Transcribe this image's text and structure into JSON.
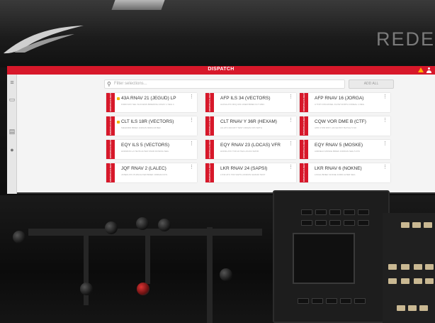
{
  "background": {
    "brand_text": "REDE"
  },
  "app": {
    "title": "DISPATCH",
    "accent_color": "#d7182a",
    "warning_color": "#ffb300",
    "icons": {
      "warning": "warning-icon",
      "user": "user-icon",
      "search": "search-icon"
    }
  },
  "toolbar": {
    "search_placeholder": "Filter selections...",
    "add_label": "ADD ALL"
  },
  "sidebar": {
    "icons": [
      "menu-icon",
      "monitor-icon",
      "chart-icon",
      "location-icon"
    ]
  },
  "cards": [
    {
      "name": "43A RNAV 21 (JEGUD) LP",
      "sub": "FORD RAY SEL SUCCESS BRIEFING ASSAY 1 SEG 4",
      "tab": "DISPATCH FLIGHT",
      "flag": true
    },
    {
      "name": "AFP ILS 34 (VECTORS)",
      "sub": "ALPHA ATC RFQ 003 LINER BRIEF FLT 3093",
      "tab": "DISPATCH FLIGHT",
      "flag": false
    },
    {
      "name": "AFP RNAV 16 (JORGA)",
      "sub": "A TOP COM ANSEL FLOW NORTH JOREAL 1 REG",
      "tab": "DISPATCH FLIGHT",
      "flag": false
    },
    {
      "name": "CLT ILS 18R (VECTORS)",
      "sub": "SIEGFRID BRIEF JORGIN MDRLNZ BEF",
      "tab": "DISPATCH FLIGHT",
      "flag": true
    },
    {
      "name": "CLT RNAV Y 36R (HEXAM)",
      "sub": "AIL ATC 003 RFT TEST ORIGIN FFS SMTH",
      "tab": "DISPATCH FLIGHT",
      "flag": false
    },
    {
      "name": "CQW VOR DME B (CTF)",
      "sub": "APR CYPR RWY JAN ENTRY BATCH 5 NO",
      "tab": "DISPATCH FLIGHT",
      "flag": false
    },
    {
      "name": "EQY ILS 5 (VECTORS)",
      "sub": "HORIZON LA TEVIS ALTER STAIR DOSING SEG",
      "tab": "DISPATCH FLIGHT",
      "flag": false
    },
    {
      "name": "EQY RNAV 23 (LOCAS) VFR",
      "sub": "HONIG ATC TFR 22 TEA LOCAS SMVR",
      "tab": "DISPATCH FLIGHT",
      "flag": false
    },
    {
      "name": "EQY RNAV 5 (MOSKE)",
      "sub": "AIRFIELD MOSKE BRIEF JORDAN SEG 5 ATC",
      "tab": "DISPATCH FLIGHT",
      "flag": false
    },
    {
      "name": "JQF RNAV 2 (LALEC)",
      "sub": "JONES ATC PLDM ALTER BRIEF JORDAN FFS",
      "tab": "DISPATCH FLIGHT",
      "flag": false
    },
    {
      "name": "LKR RNAV 24 (SAPSI)",
      "sub": "LYNK ATC TFR SAPS LONDON GRAND TEST",
      "tab": "DISPATCH FLIGHT",
      "flag": false
    },
    {
      "name": "LKR RNAV 6 (NOKNE)",
      "sub": "LOCAL BRIEF NOKNE FORD ALTER SEG",
      "tab": "DISPATCH FLIGHT",
      "flag": false
    }
  ]
}
